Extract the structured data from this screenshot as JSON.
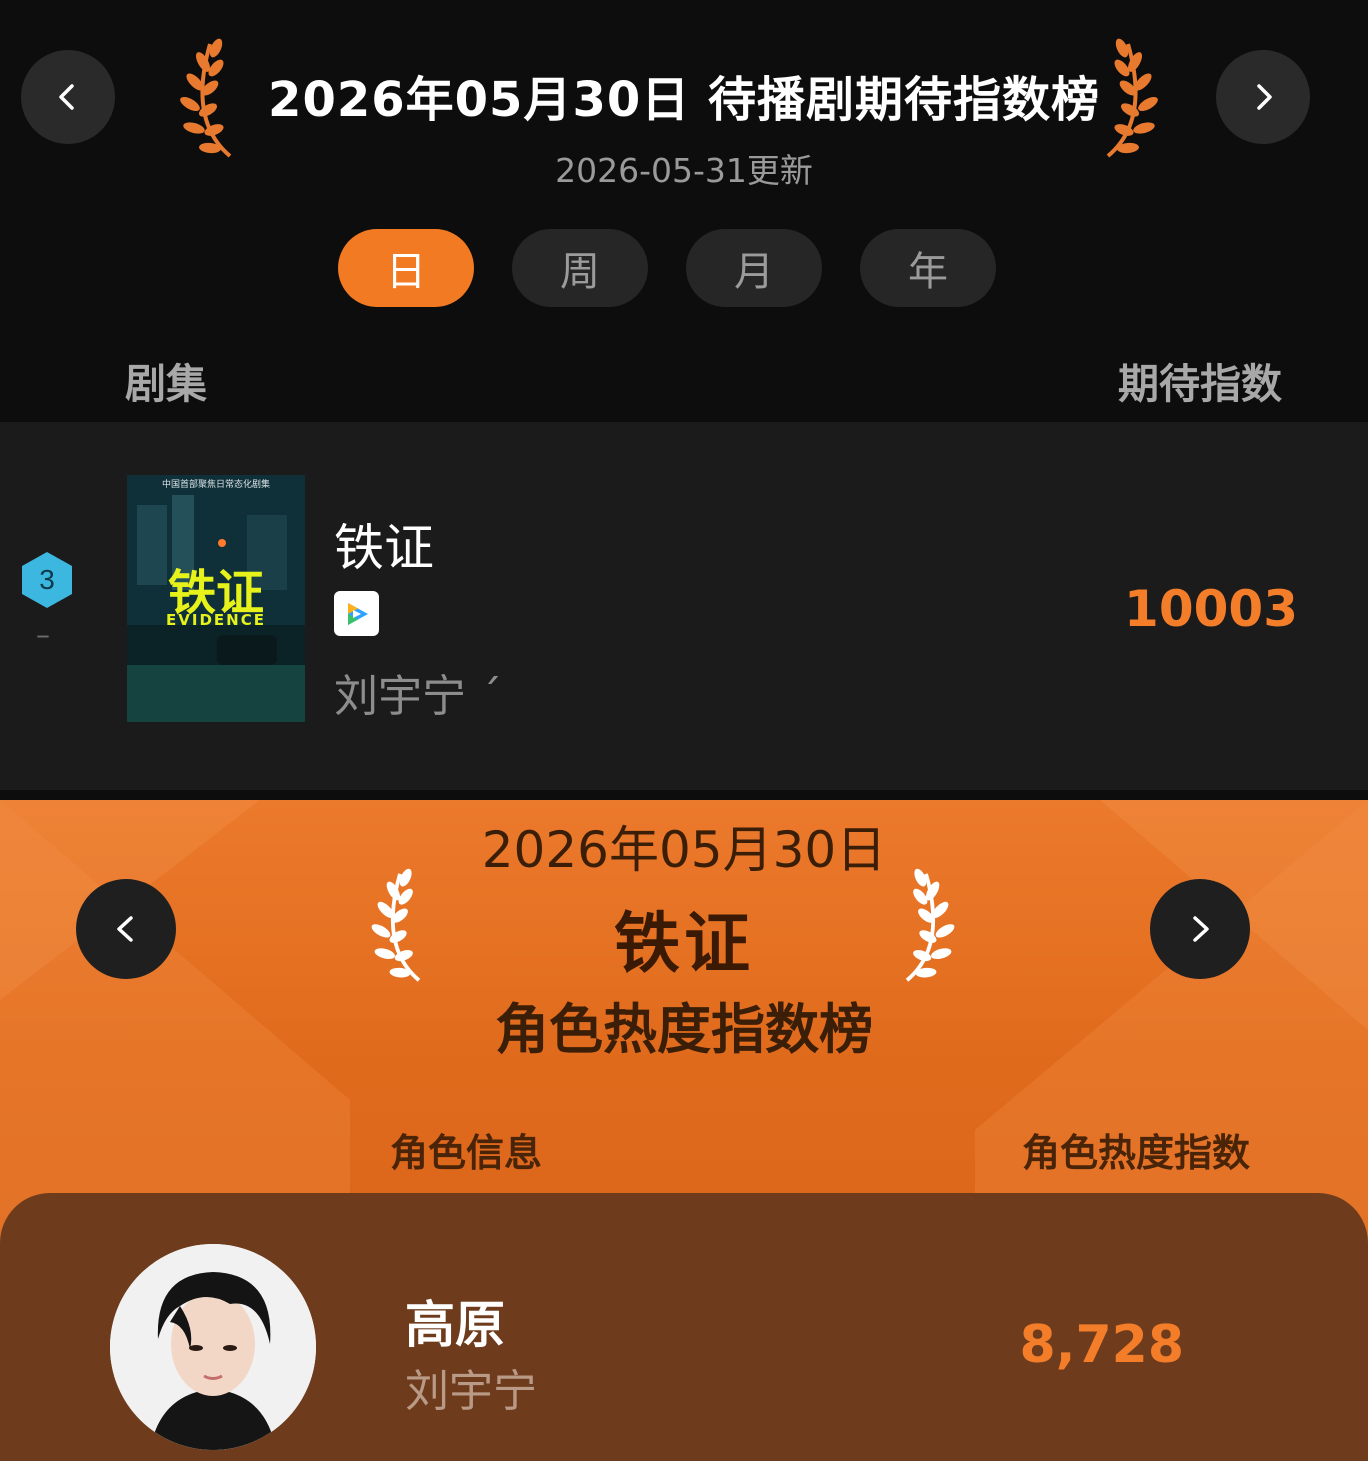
{
  "header": {
    "title": "2026年05月30日  待播剧期待指数榜",
    "update": "2026-05-31更新"
  },
  "tabs": [
    {
      "label": "日",
      "active": true
    },
    {
      "label": "周",
      "active": false
    },
    {
      "label": "月",
      "active": false
    },
    {
      "label": "年",
      "active": false
    }
  ],
  "columns": {
    "left": "剧集",
    "right": "期待指数"
  },
  "drama": {
    "rank": "3",
    "rank_change": "–",
    "title": "铁证",
    "actors": "刘宇宁 ˊ",
    "score": "10003",
    "poster_title": "铁证",
    "poster_subtitle": "EVIDENCE",
    "poster_top_text": "中国首部聚焦日常态化剧集",
    "platform_icon": "tencent-video-icon"
  },
  "role_board": {
    "date": "2026年05月30日",
    "drama": "铁证",
    "title": "角色热度指数榜",
    "col_left": "角色信息",
    "col_right": "角色热度指数",
    "role": {
      "name": "高原",
      "actor": "刘宇宁",
      "score": "8,728"
    }
  },
  "colors": {
    "accent": "#f27a22",
    "dark_bg": "#0d0d0d",
    "card_bg": "#1b1b1b",
    "orange_bg": "#e06a1c",
    "role_card": "#6e3c1c",
    "rank_badge": "#3cb7e0"
  }
}
